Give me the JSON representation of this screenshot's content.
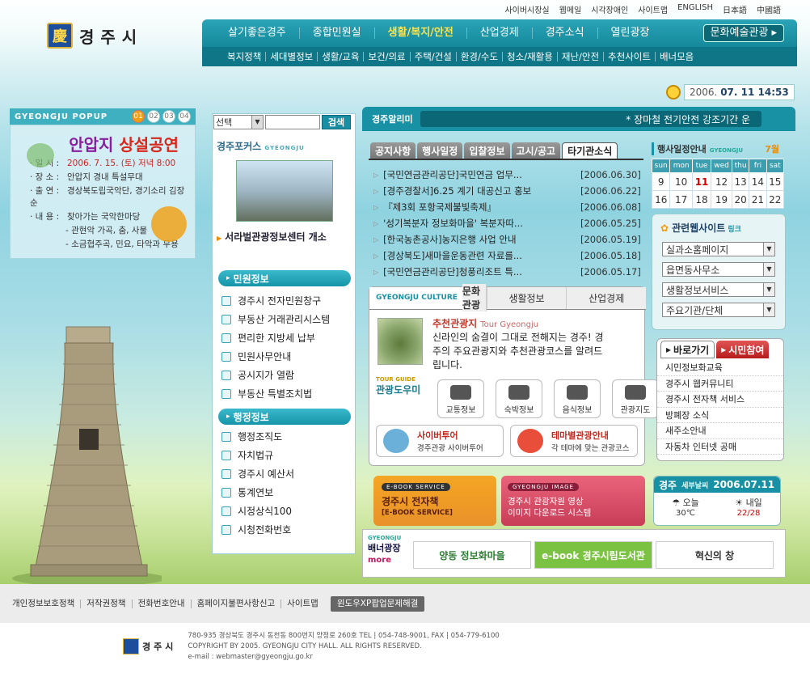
{
  "top_links": [
    "사이버시장실",
    "웹메일",
    "시각장애인",
    "사이트맵",
    "ENGLISH",
    "日本語",
    "中國語"
  ],
  "logo": {
    "text": "경주시",
    "mark": "慶"
  },
  "gnb": {
    "items": [
      "살기좋은경주",
      "종합민원실",
      "생활/복지/안전",
      "산업경제",
      "경주소식",
      "열린광장"
    ],
    "active_index": 2,
    "culture_button": "문화예술관광 ▸"
  },
  "lnb": [
    "복지정책",
    "세대별정보",
    "생활/교육",
    "보건/의료",
    "주택/건설",
    "환경/수도",
    "청소/재활용",
    "재난/안전",
    "추천사이트",
    "배너모음"
  ],
  "clock": {
    "date": "2006.",
    "time": "07. 11 14:53"
  },
  "popup": {
    "header": "GYEONGJU POPUP",
    "pages": [
      "01",
      "02",
      "03",
      "04"
    ],
    "title_a": "안압지",
    "title_b": "상설공연",
    "rows": [
      {
        "k": "· 일   시 :",
        "v": "2006. 7. 15. (토) 저녁 8:00",
        "red": true
      },
      {
        "k": "· 장   소 :",
        "v": "안압지 경내 특설무대"
      },
      {
        "k": "· 출   연 :",
        "v": "경상북도립국악단, 경기소리 김장순"
      },
      {
        "k": "· 내   용 :",
        "v": "찾아가는 국악한마당"
      }
    ],
    "extra": [
      "- 관현악 가곡, 춤, 사물",
      "- 소금협주곡, 민요, 타악과 무용"
    ]
  },
  "search": {
    "select": "선택",
    "button": "검색"
  },
  "focus": {
    "title": "경주포커스",
    "sub": "GYEONGJU",
    "caption": "서라벌관광정보센터 개소"
  },
  "minwon": {
    "title": "민원정보",
    "items": [
      "경주시 전자민원창구",
      "부동산 거래관리시스템",
      "편리한 지방세 납부",
      "민원사무안내",
      "공시지가 열람",
      "부동산 특별조치법"
    ]
  },
  "haengjeong": {
    "title": "행정정보",
    "items": [
      "행정조직도",
      "자치법규",
      "경주시 예산서",
      "통계연보",
      "시정상식100",
      "시청전화번호"
    ]
  },
  "news": {
    "label": "경주알리미",
    "ticker": "* 장마철 전기안전 강조기간 운"
  },
  "notice": {
    "tabs": [
      "공지사항",
      "행사일정",
      "입찰정보",
      "고시/공고",
      "타기관소식"
    ],
    "active": 4,
    "items": [
      {
        "t": "[국민연금관리공단]국민연금 업무...",
        "d": "[2006.06.30]"
      },
      {
        "t": "[경주경찰서]6.25 계기 대공신고 홍보",
        "d": "[2006.06.22]"
      },
      {
        "t": "『제3회 포항국제불빛축제』",
        "d": "[2006.06.08]"
      },
      {
        "t": "'성기복분자 정보화마을' 복분자따...",
        "d": "[2006.05.25]"
      },
      {
        "t": "[한국농촌공사]농지은행 사업 안내",
        "d": "[2006.05.19]"
      },
      {
        "t": "[경상북도]새마을운동관련 자료를...",
        "d": "[2006.05.18]"
      },
      {
        "t": "[국민연금관리공단]청풍리조트 특...",
        "d": "[2006.05.17]"
      }
    ]
  },
  "calendar": {
    "title": "행사일정안내",
    "sub": "GYEONGJU",
    "month": "7월",
    "days": [
      "sun",
      "mon",
      "tue",
      "wed",
      "thu",
      "fri",
      "sat"
    ],
    "rows": [
      [
        "9",
        "10",
        "11",
        "12",
        "13",
        "14",
        "15"
      ],
      [
        "16",
        "17",
        "18",
        "19",
        "20",
        "21",
        "22"
      ]
    ],
    "today": "11"
  },
  "related": {
    "title": "관련웹사이트",
    "sub": "링크",
    "selects": [
      "실과소홈페이지",
      "읍면동사무소",
      "생활정보서비스",
      "주요기관/단체"
    ]
  },
  "culture": {
    "tabs": [
      "GYEONGJU CULTURE",
      "문화관광",
      "생활정보",
      "산업경제"
    ],
    "heading": "추천관광지",
    "heading_en": "Tour Gyeongju",
    "text": "신라인의 숨결이 그대로 전해지는 경주! 경주의 주요관광지와 추천관광코스를 알려드립니다.",
    "guide_sub": "TOUR GUIDE",
    "guide": "관광도우미",
    "icons": [
      "교통정보",
      "숙박정보",
      "음식정보",
      "관광지도"
    ],
    "btn1": {
      "t": "사이버투어",
      "s": "경주관광 사이버투어"
    },
    "btn2": {
      "t": "테마별관광안내",
      "s": "각 테마에 맞는 관광코스"
    }
  },
  "quick": {
    "tabs": [
      "바로가기",
      "시민참여"
    ],
    "items": [
      "시민정보화교육",
      "경주시 웹커뮤니티",
      "경주시 전자책 서비스",
      "방폐장 소식",
      "새주소안내",
      "자동차 인터넷 공매"
    ]
  },
  "ebook": {
    "tag": "E-BOOK SERVICE",
    "title": "경주시 전자책",
    "sub": "[E-BOOK SERVICE]"
  },
  "image": {
    "tag": "GYEONGJU IMAGE",
    "title": "경주시 관광자원 영상",
    "sub": "이미지 다운로드 시스템"
  },
  "weather": {
    "title": "경주",
    "sub": "세부날씨",
    "date": "2006.07.11",
    "today": "오늘",
    "today_t": "30℃",
    "tomorrow": "내일",
    "tomorrow_t": "22/28"
  },
  "banner": {
    "sub": "GYEONGJU",
    "title": "배너광장",
    "more": "more",
    "items": [
      "양동 정보화마을",
      "e-book 경주시립도서관",
      "혁신의 창"
    ]
  },
  "footnav": [
    "개인정보보호정책",
    "저작권정책",
    "전화번호안내",
    "홈페이지불편사항신고",
    "사이트맵",
    "윈도우XP팝업문제해결"
  ],
  "footer": {
    "mark": "경주시",
    "addr": "780-935  경상북도 경주시 동천동 800번지 양정로 260호   TEL | 054-748-9001,  FAX | 054-779-6100",
    "copy": "COPYRIGHT BY 2005. GYEONGJU CITY HALL. ALL RIGHTS RESERVED.",
    "email": "e-mail : webmaster@gyeongju.go.kr"
  }
}
